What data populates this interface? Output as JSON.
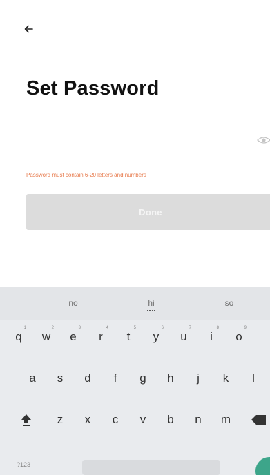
{
  "header": {
    "back_icon": "arrow-left-icon",
    "title": "Set Password"
  },
  "form": {
    "password_value": "",
    "password_placeholder": "",
    "eye_icon": "eye-toggle-icon",
    "hint": "Password must contain 6-20 letters and numbers",
    "done_label": "Done",
    "done_enabled": false
  },
  "keyboard": {
    "suggestions": [
      "no",
      "hi",
      "so"
    ],
    "row1": [
      {
        "key": "q",
        "hint": "1"
      },
      {
        "key": "w",
        "hint": "2"
      },
      {
        "key": "e",
        "hint": "3"
      },
      {
        "key": "r",
        "hint": "4"
      },
      {
        "key": "t",
        "hint": "5"
      },
      {
        "key": "y",
        "hint": "6"
      },
      {
        "key": "u",
        "hint": "7"
      },
      {
        "key": "i",
        "hint": "8"
      },
      {
        "key": "o",
        "hint": "9"
      }
    ],
    "row2": [
      "a",
      "s",
      "d",
      "f",
      "g",
      "h",
      "j",
      "k",
      "l"
    ],
    "row3": [
      "z",
      "x",
      "c",
      "v",
      "b",
      "n",
      "m"
    ],
    "symbols_label": "?123",
    "shift_icon": "shift-icon",
    "backspace_icon": "backspace-icon",
    "enter_icon": "enter-icon"
  },
  "colors": {
    "hint": "#e77a4c",
    "done_disabled_bg": "#dcdcdc",
    "keyboard_bg": "#e9ebee",
    "enter_key": "#3da58a"
  }
}
